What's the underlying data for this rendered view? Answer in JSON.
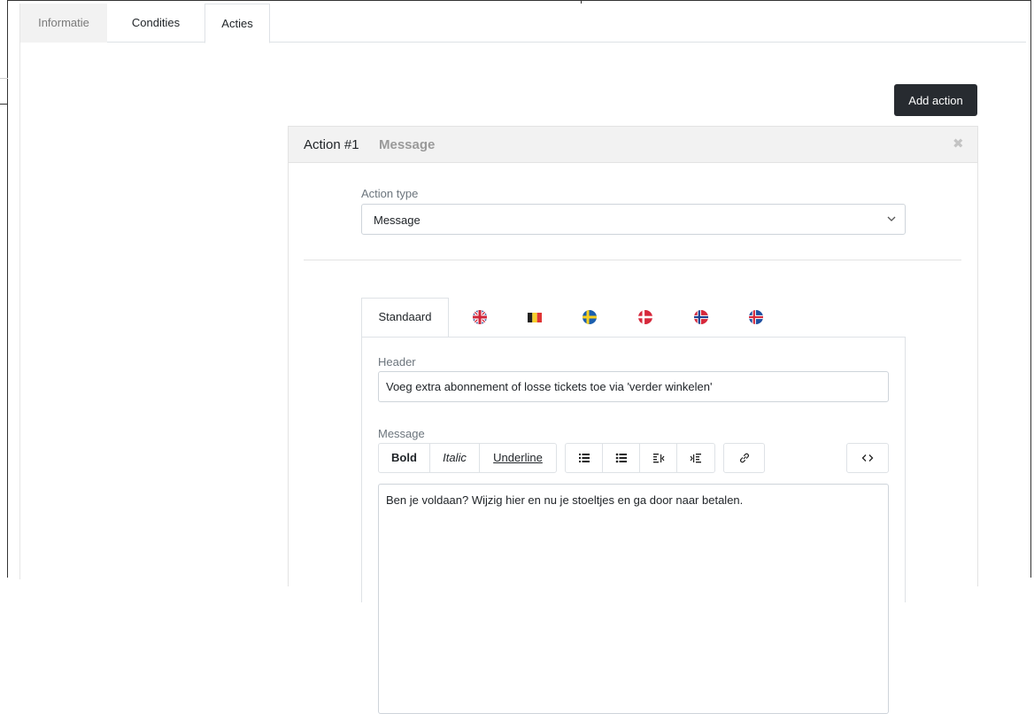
{
  "tabs": [
    {
      "label": "Informatie"
    },
    {
      "label": "Condities"
    },
    {
      "label": "Acties"
    }
  ],
  "add_action_label": "Add action",
  "action": {
    "title": "Action #1",
    "subtitle": "Message",
    "close_glyph": "✖",
    "type_label": "Action type",
    "type_value": "Message"
  },
  "languages": {
    "standard_label": "Standaard",
    "flags": [
      "flag-uk-icon",
      "flag-belgium-icon",
      "flag-sweden-icon",
      "flag-denmark-icon",
      "flag-norway-icon",
      "flag-iceland-icon"
    ]
  },
  "form": {
    "header_label": "Header",
    "header_value": "Voeg extra abonnement of losse tickets toe via 'verder winkelen'",
    "message_label": "Message",
    "message_value": "Ben je voldaan? Wijzig hier en nu je stoeltjes en ga door naar betalen."
  },
  "toolbar": {
    "bold": "Bold",
    "italic": "Italic",
    "underline": "Underline"
  },
  "colors": {
    "dark_button": "#272b30",
    "header_bg": "#f2f2f2",
    "border": "#dee2e6"
  }
}
